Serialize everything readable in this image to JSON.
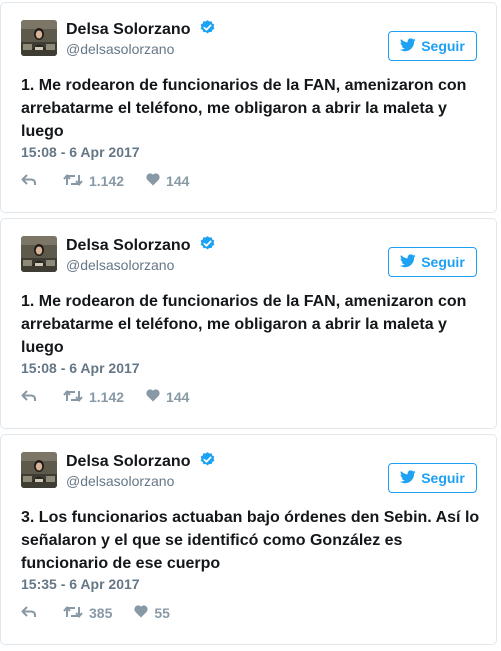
{
  "accent": "#1da1f2",
  "tweets": [
    {
      "name": "Delsa Solorzano",
      "handle": "@delsasolorzano",
      "follow_label": "Seguir",
      "text": "1. Me rodearon de funcionarios de la FAN, amenizaron con arrebatarme el teléfono, me obligaron a abrir la maleta y luego",
      "timestamp": "15:08 - 6 Apr 2017",
      "retweets": "1.142",
      "likes": "144"
    },
    {
      "name": "Delsa Solorzano",
      "handle": "@delsasolorzano",
      "follow_label": "Seguir",
      "text": "1. Me rodearon de funcionarios de la FAN, amenizaron con arrebatarme el teléfono, me obligaron a abrir la maleta y luego",
      "timestamp": "15:08 - 6 Apr 2017",
      "retweets": "1.142",
      "likes": "144"
    },
    {
      "name": "Delsa Solorzano",
      "handle": "@delsasolorzano",
      "follow_label": "Seguir",
      "text": "3. Los funcionarios actuaban bajo órdenes den Sebin. Así lo señalaron y el que se identificó como González es funcionario de ese cuerpo",
      "timestamp": "15:35 - 6 Apr 2017",
      "retweets": "385",
      "likes": "55"
    }
  ]
}
